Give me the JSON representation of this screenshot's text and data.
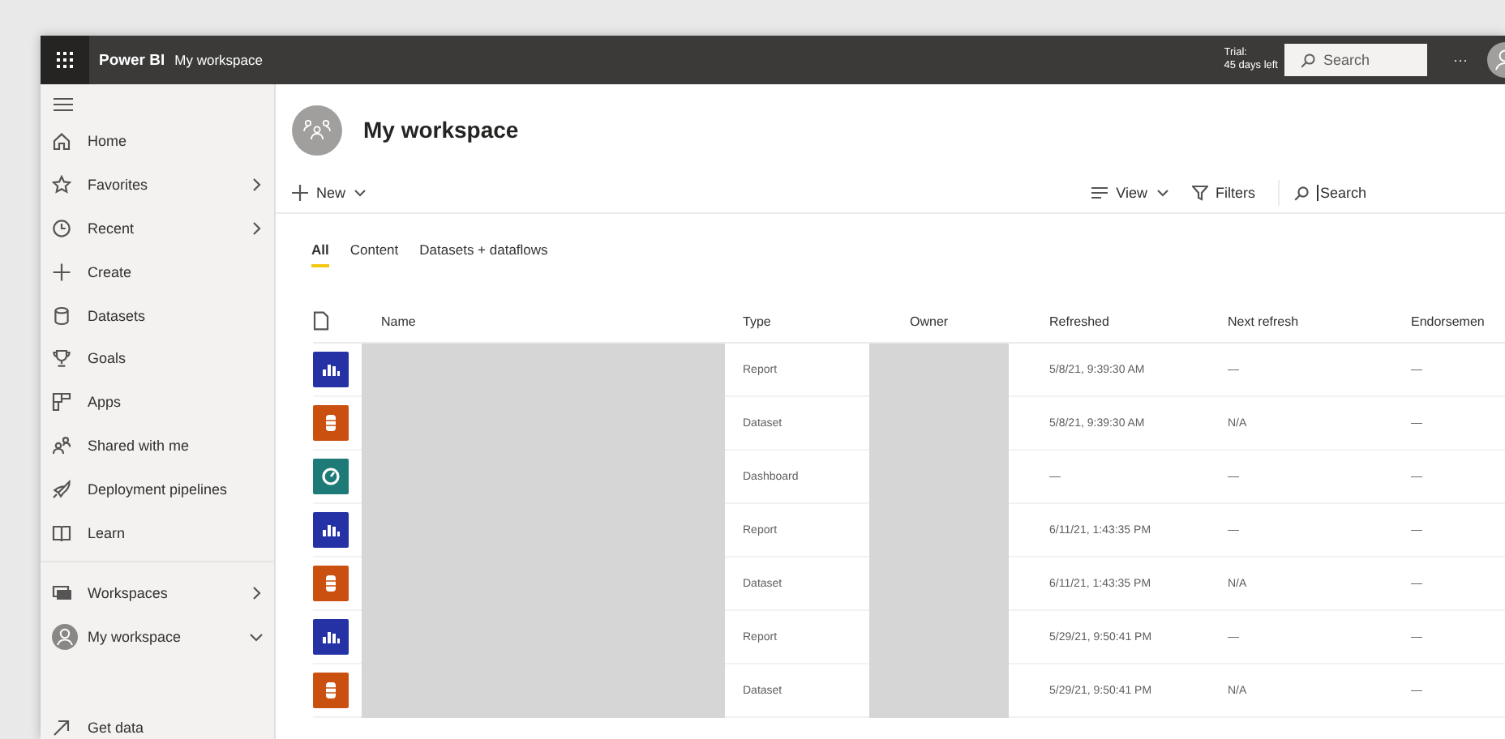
{
  "topbar": {
    "app_name": "Power BI",
    "breadcrumb": "My workspace",
    "trial": "Trial:",
    "days_left": "45 days left",
    "search": {
      "placeholder": "Search"
    },
    "more": "···"
  },
  "sidebar": {
    "items": [
      {
        "label": "Home"
      },
      {
        "label": "Favorites"
      },
      {
        "label": "Recent"
      },
      {
        "label": "Create"
      },
      {
        "label": "Datasets"
      },
      {
        "label": "Goals"
      },
      {
        "label": "Apps"
      },
      {
        "label": "Shared with me"
      },
      {
        "label": "Deployment pipelines"
      },
      {
        "label": "Learn"
      }
    ],
    "workspace_items": [
      {
        "label": "Workspaces"
      },
      {
        "label": "My workspace"
      }
    ],
    "footer_items": [
      {
        "label": "Get data"
      }
    ]
  },
  "workspace": {
    "title": "My workspace"
  },
  "toolbar": {
    "new": "New",
    "view": "View",
    "filters": "Filters",
    "search": {
      "value": "Search"
    }
  },
  "tabs": [
    {
      "label": "All",
      "selected": true
    },
    {
      "label": "Content",
      "selected": false
    },
    {
      "label": "Datasets + dataflows",
      "selected": false
    }
  ],
  "table": {
    "columns": [
      "Name",
      "Type",
      "Owner",
      "Refreshed",
      "Next refresh",
      "Endorsemen"
    ],
    "rows": [
      {
        "kind": "report",
        "type": "Report",
        "refreshed": "5/8/21, 9:39:30 AM",
        "next_refresh": "—",
        "endorsement": "—"
      },
      {
        "kind": "dataset",
        "type": "Dataset",
        "refreshed": "5/8/21, 9:39:30 AM",
        "next_refresh": "N/A",
        "endorsement": "—"
      },
      {
        "kind": "dashboard",
        "type": "Dashboard",
        "refreshed": "—",
        "next_refresh": "—",
        "endorsement": "—"
      },
      {
        "kind": "report",
        "type": "Report",
        "refreshed": "6/11/21, 1:43:35 PM",
        "next_refresh": "—",
        "endorsement": "—"
      },
      {
        "kind": "dataset",
        "type": "Dataset",
        "refreshed": "6/11/21, 1:43:35 PM",
        "next_refresh": "N/A",
        "endorsement": "—"
      },
      {
        "kind": "report",
        "type": "Report",
        "refreshed": "5/29/21, 9:50:41 PM",
        "next_refresh": "—",
        "endorsement": "—"
      },
      {
        "kind": "dataset",
        "type": "Dataset",
        "refreshed": "5/29/21, 9:50:41 PM",
        "next_refresh": "N/A",
        "endorsement": "—"
      }
    ]
  }
}
